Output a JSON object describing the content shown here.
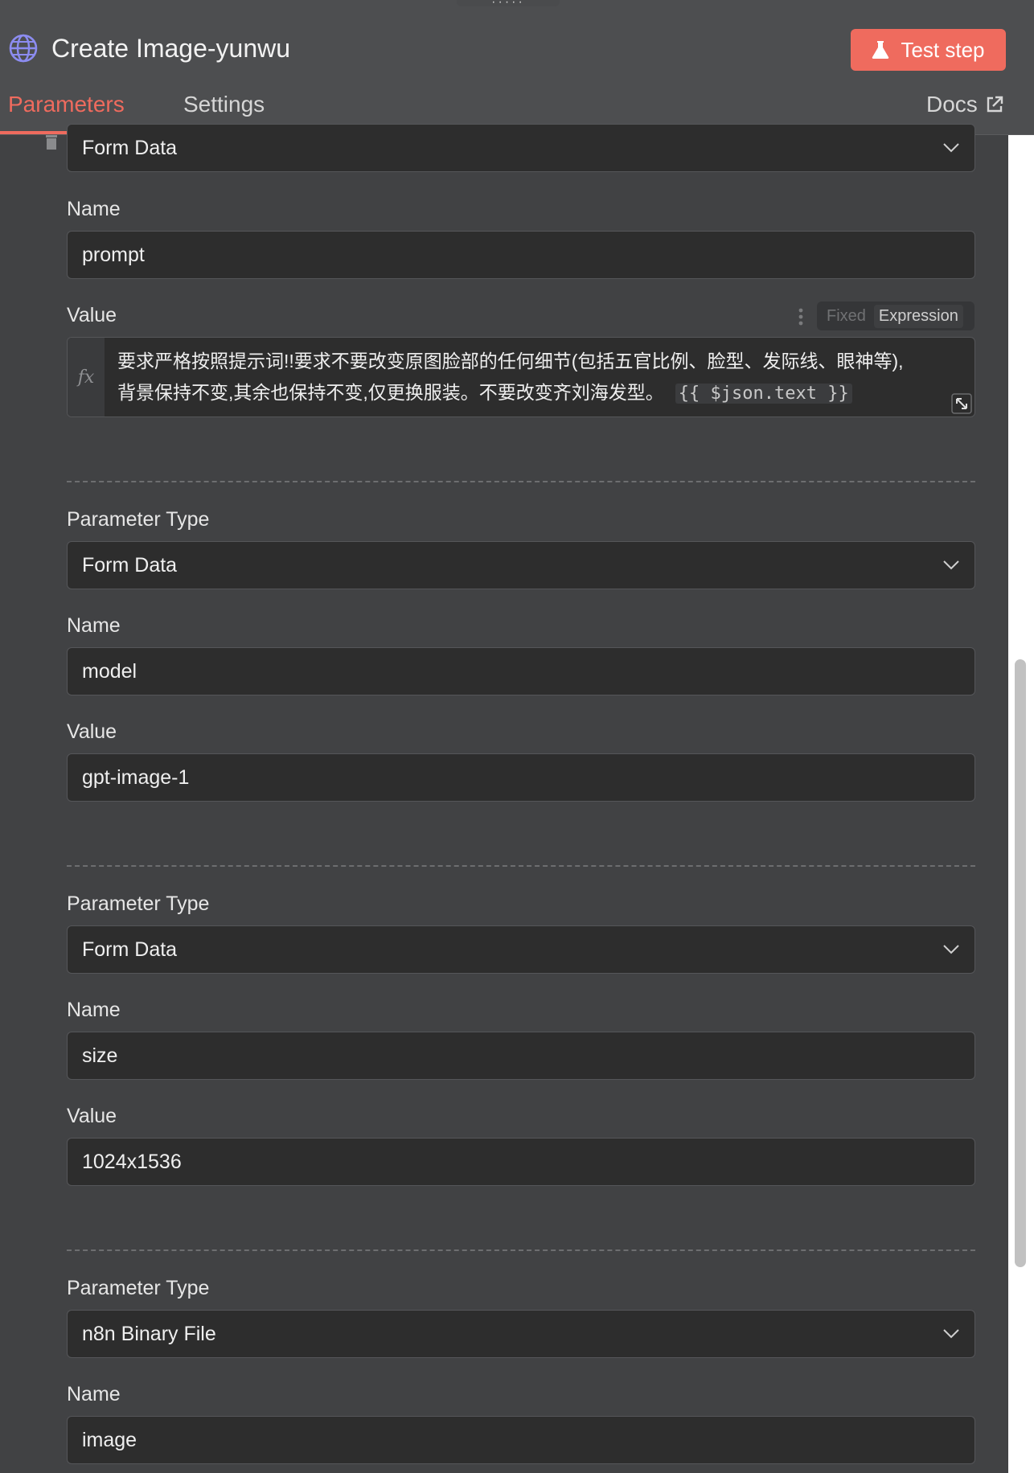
{
  "header": {
    "title": "Create Image-yunwu",
    "test_button": "Test step",
    "tabs": [
      "Parameters",
      "Settings"
    ],
    "docs": "Docs"
  },
  "params": [
    {
      "type": "Form Data",
      "name_label": "Name",
      "name": "prompt",
      "value_label": "Value",
      "value_mode": {
        "fixed": "Fixed",
        "expression": "Expression"
      },
      "value_text": "要求严格按照提示词!!要求不要改变原图脸部的任何细节(包括五官比例、脸型、发际线、眼神等),背景保持不变,其余也保持不变,仅更换服装。不要改变齐刘海发型。",
      "value_code": "{{ $json.text }}",
      "value_line1": "要求严格按照提示词!!要求不要改变原图脸部的任何细节(包括五官比例、脸型、发际线、眼神等),",
      "value_line2": "背景保持不变,其余也保持不变,仅更换服装。不要改变齐刘海发型。"
    },
    {
      "type_label": "Parameter Type",
      "type": "Form Data",
      "name_label": "Name",
      "name": "model",
      "value_label": "Value",
      "value": "gpt-image-1"
    },
    {
      "type_label": "Parameter Type",
      "type": "Form Data",
      "name_label": "Name",
      "name": "size",
      "value_label": "Value",
      "value": "1024x1536"
    },
    {
      "type_label": "Parameter Type",
      "type": "n8n Binary File",
      "name_label": "Name",
      "name": "image"
    }
  ],
  "colors": {
    "accent": "#ef6b5e",
    "panel": "#414244",
    "field": "#2d2d2d"
  }
}
